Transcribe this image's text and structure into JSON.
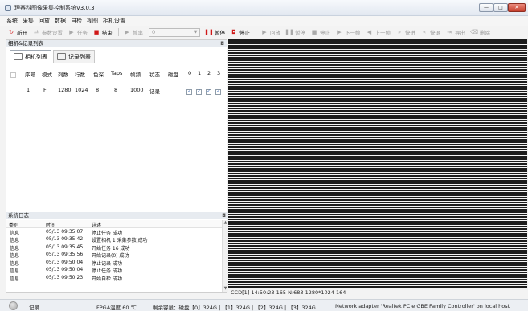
{
  "window": {
    "title": "理赛科图像采集控制系统V3.0.3",
    "min": "—",
    "max": "□",
    "close": "✕"
  },
  "menu": [
    "系统",
    "采集",
    "回放",
    "数据",
    "自检",
    "视图",
    "相机设置"
  ],
  "toolbar": {
    "new": "新开",
    "params": "参数设置",
    "task": "任务",
    "end": "结束",
    "frame_label": "帧率",
    "frame_value": "0",
    "pause": "暂停",
    "stop": "停止",
    "playback": "回放",
    "pause2": "暂停",
    "stop2": "停止",
    "next_frame": "下一帧",
    "prev_frame": "上一帧",
    "fast_forward": "快进",
    "fast_rewind": "快退",
    "export": "导出",
    "delete": "删除"
  },
  "camera_panel": {
    "title": "相机&记录列表",
    "tabs": [
      "相机列表",
      "记录列表"
    ],
    "columns": [
      "序号",
      "模式",
      "列数",
      "行数",
      "色深",
      "Taps",
      "帧频",
      "状态",
      "磁盘",
      "0",
      "1",
      "2",
      "3"
    ],
    "rows": [
      {
        "index": "1",
        "mode": "F",
        "cols": "1280",
        "rows": "1024",
        "depth": "8",
        "taps": "8",
        "rate": "1000",
        "status": "记录"
      }
    ]
  },
  "log_panel": {
    "title": "系统日志",
    "columns": [
      "类别",
      "时间",
      "详述"
    ],
    "rows": [
      {
        "type": "信息",
        "time": "05/13 09:35:07",
        "detail": "停止任务 成功"
      },
      {
        "type": "信息",
        "time": "05/13 09:35:42",
        "detail": "设置相机 1 采集参数 成功"
      },
      {
        "type": "信息",
        "time": "05/13 09:35:45",
        "detail": "开始任务 16 成功"
      },
      {
        "type": "信息",
        "time": "05/13 09:35:56",
        "detail": "开始记录(0) 成功"
      },
      {
        "type": "信息",
        "time": "05/13 09:50:04",
        "detail": "停止记录 成功"
      },
      {
        "type": "信息",
        "time": "05/13 09:50:04",
        "detail": "停止任务 成功"
      },
      {
        "type": "信息",
        "time": "05/13 09:50:23",
        "detail": "开始自检 成功"
      }
    ]
  },
  "image_info": "CCD[1] 14:50:23 165  N:683  1280*1024 164",
  "status": {
    "mode": "记录",
    "fpga_temp": "FPGA温度 60 ℃",
    "disk": "剩余容量：磁盘【0】324G | 【1】324G | 【2】324G | 【3】324G",
    "network": "Network adapter 'Realtek PCIe GBE Family Controller' on local host"
  }
}
